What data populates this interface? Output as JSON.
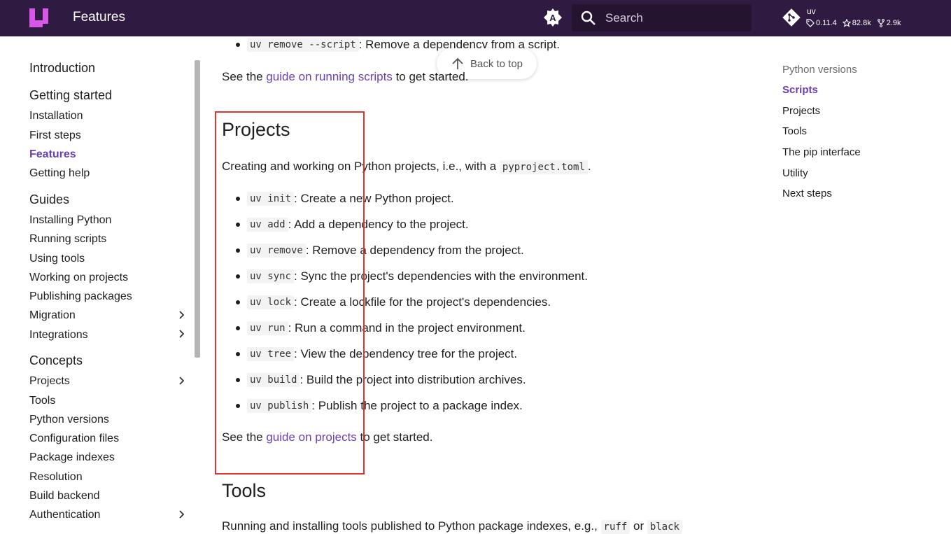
{
  "header": {
    "title": "Features",
    "search_placeholder": "Search",
    "repo": {
      "name": "uv",
      "version": "0.11.4",
      "stars": "82.8k",
      "forks": "2.9k"
    }
  },
  "colors": {
    "header_bg": "#2f1a42",
    "accent": "#6a3fb5",
    "logo": "#d957e8"
  },
  "sidebar": {
    "intro": "Introduction",
    "getting_started": {
      "title": "Getting started",
      "items": [
        "Installation",
        "First steps",
        "Features",
        "Getting help"
      ]
    },
    "guides": {
      "title": "Guides",
      "items": [
        "Installing Python",
        "Running scripts",
        "Using tools",
        "Working on projects",
        "Publishing packages",
        "Migration",
        "Integrations"
      ]
    },
    "concepts": {
      "title": "Concepts",
      "items": [
        "Projects",
        "Tools",
        "Python versions",
        "Configuration files",
        "Package indexes",
        "Resolution",
        "Build backend",
        "Authentication"
      ]
    }
  },
  "main": {
    "back_to_top": "Back to top",
    "top_item": {
      "code": "uv remove --script",
      "text": ": Remove a dependency from a script."
    },
    "scripts_see": {
      "pre": "See the ",
      "link": "guide on running scripts",
      "post": " to get started."
    },
    "projects": {
      "heading": "Projects",
      "intro_pre": "Creating and working on Python projects, i.e., with a ",
      "intro_code": "pyproject.toml",
      "intro_post": ".",
      "items": [
        {
          "code": "uv init",
          "text": ": Create a new Python project."
        },
        {
          "code": "uv add",
          "text": ": Add a dependency to the project."
        },
        {
          "code": "uv remove",
          "text": ": Remove a dependency from the project."
        },
        {
          "code": "uv sync",
          "text": ": Sync the project's dependencies with the environment."
        },
        {
          "code": "uv lock",
          "text": ": Create a lockfile for the project's dependencies."
        },
        {
          "code": "uv run",
          "text": ": Run a command in the project environment."
        },
        {
          "code": "uv tree",
          "text": ": View the dependency tree for the project."
        },
        {
          "code": "uv build",
          "text": ": Build the project into distribution archives."
        },
        {
          "code": "uv publish",
          "text": ": Publish the project to a package index."
        }
      ],
      "see": {
        "pre": "See the ",
        "link": "guide on projects",
        "post": " to get started."
      }
    },
    "tools": {
      "heading": "Tools",
      "intro_pre": "Running and installing tools published to Python package indexes, e.g., ",
      "code1": "ruff",
      "mid": " or ",
      "code2": "black"
    }
  },
  "toc": {
    "items": [
      "Python versions",
      "Scripts",
      "Projects",
      "Tools",
      "The pip interface",
      "Utility",
      "Next steps"
    ]
  }
}
